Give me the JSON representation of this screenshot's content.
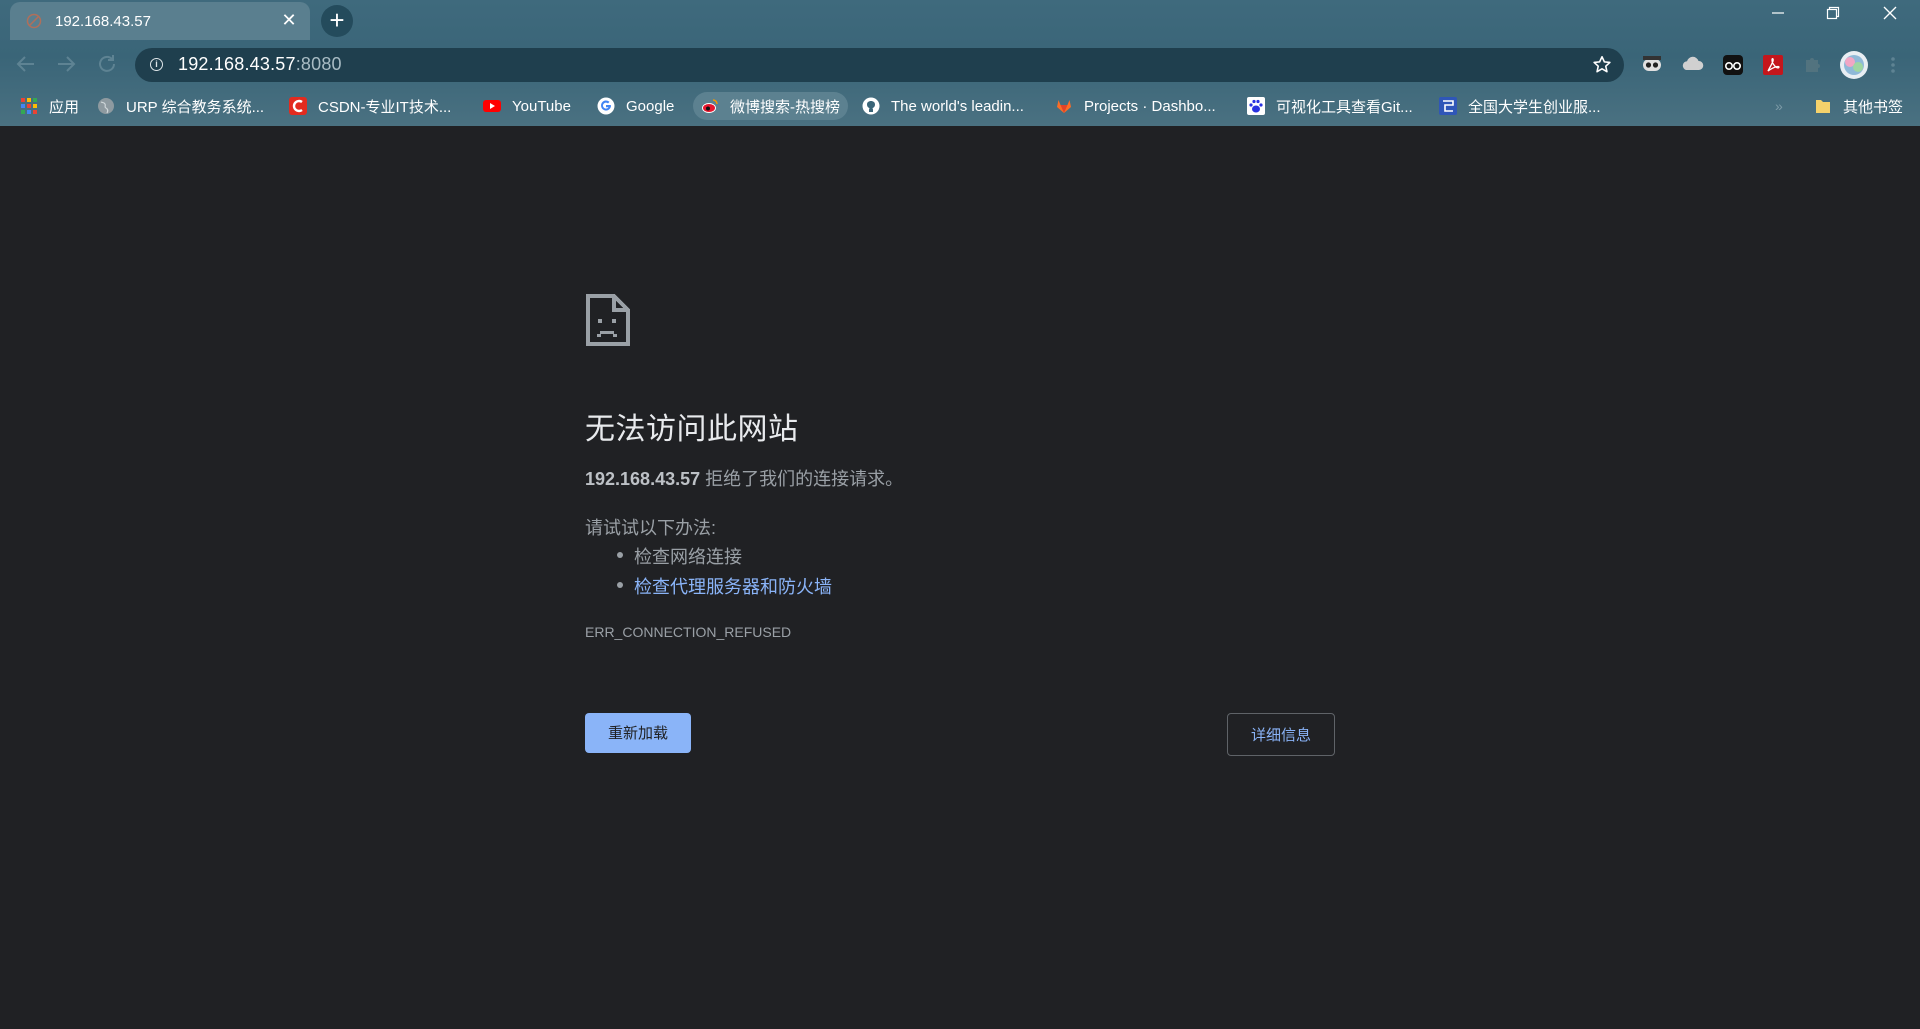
{
  "tab": {
    "title": "192.168.43.57",
    "close": "✕"
  },
  "newtab": {
    "label": "+"
  },
  "window": {
    "minimize": "—",
    "maximize": "❐",
    "close": "✕"
  },
  "omnibox": {
    "host": "192.168.43.57",
    "port": ":8080",
    "info": "i"
  },
  "bookmarks": [
    {
      "label": "应用"
    },
    {
      "label": "URP 综合教务系统..."
    },
    {
      "label": "CSDN-专业IT技术..."
    },
    {
      "label": "YouTube"
    },
    {
      "label": "Google"
    },
    {
      "label": "微博搜索-热搜榜"
    },
    {
      "label": "The world's leadin..."
    },
    {
      "label": "Projects · Dashbo..."
    },
    {
      "label": "可视化工具查看Git..."
    },
    {
      "label": "全国大学生创业服..."
    },
    {
      "label": "其他书签"
    }
  ],
  "bookmarks_overflow": "»",
  "error_page": {
    "heading": "无法访问此网站",
    "host": "192.168.43.57",
    "message": " 拒绝了我们的连接请求。",
    "try_label": "请试试以下办法:",
    "suggestions": [
      "检查网络连接",
      "检查代理服务器和防火墙"
    ],
    "error_code": "ERR_CONNECTION_REFUSED",
    "reload_button": "重新加载",
    "details_button": "详细信息"
  },
  "colors": {
    "page_background": "#202124",
    "link": "#8ab4f8",
    "button": "#8ab4f8",
    "chrome": "#3f6a7d"
  }
}
